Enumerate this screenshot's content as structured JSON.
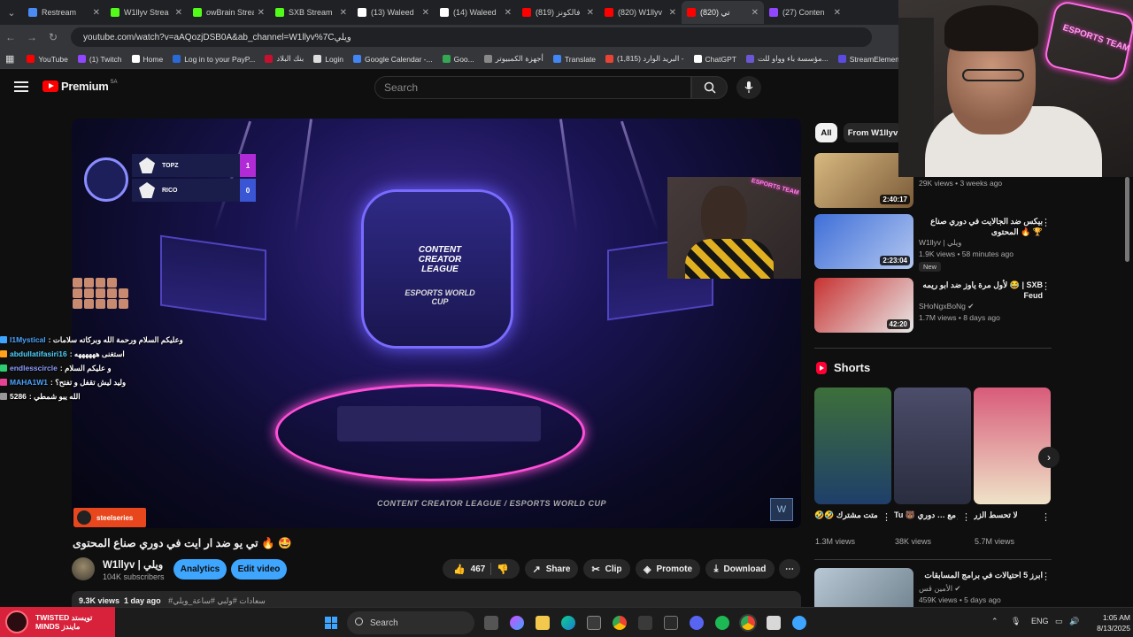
{
  "browser": {
    "tabs": [
      {
        "label": "Restream",
        "color": "#4a8bf5",
        "active": false
      },
      {
        "label": "W1llyv Strea",
        "color": "#53fc18",
        "active": false
      },
      {
        "label": "owBrain Strea",
        "color": "#53fc18",
        "active": false
      },
      {
        "label": "SXB Stream",
        "color": "#53fc18",
        "active": false
      },
      {
        "label": "(13) Waleed",
        "color": "#ffffff",
        "active": false
      },
      {
        "label": "(14) Waleed",
        "color": "#ffffff",
        "active": false
      },
      {
        "label": "(819) فالكونز",
        "color": "#ff0000",
        "active": false
      },
      {
        "label": "(820) W1llyv",
        "color": "#ff0000",
        "active": false
      },
      {
        "label": "(820) تي",
        "color": "#ff0000",
        "active": true
      },
      {
        "label": "(27) Conten",
        "color": "#9146ff",
        "active": false
      }
    ],
    "url": "youtube.com/watch?v=aAQozjDSB0A&ab_channel=W1llyv%7Cويلي",
    "bookmarks": [
      {
        "label": "YouTube",
        "color": "#ff0000"
      },
      {
        "label": "(1) Twitch",
        "color": "#9146ff"
      },
      {
        "label": "Home",
        "color": "#ffffff"
      },
      {
        "label": "Log in to your PayP...",
        "color": "#2a6ad8"
      },
      {
        "label": "بنك البلاد",
        "color": "#c8102e"
      },
      {
        "label": "Login",
        "color": "#dddddd"
      },
      {
        "label": "Google Calendar -...",
        "color": "#4285f4"
      },
      {
        "label": "Goo...",
        "color": "#34a853"
      },
      {
        "label": "أجهزة الكمبيوتر",
        "color": "#888888"
      },
      {
        "label": "Translate",
        "color": "#4285f4"
      },
      {
        "label": "(1,815) البريد الوارد -",
        "color": "#ea4335"
      },
      {
        "label": "ChatGPT",
        "color": "#ffffff"
      },
      {
        "label": "مؤسسة باء وواو للت...",
        "color": "#6b57d6"
      },
      {
        "label": "StreamElements - M",
        "color": "#5b4be3"
      }
    ]
  },
  "youtube": {
    "brand": "Premium",
    "country": "SA",
    "search_placeholder": "Search"
  },
  "video": {
    "scoreboard": [
      {
        "team": "TOPZ",
        "score": "1",
        "score_color": "#b02bd6"
      },
      {
        "team": "RICO",
        "score": "0",
        "score_color": "#3a56d4"
      }
    ],
    "stage_logo_top": "CONTENT CREATOR LEAGUE",
    "stage_logo_bottom": "ESPORTS WORLD CUP",
    "facecam_sign": "ESPORTS TEAM",
    "sponsor": "steelseries",
    "lower_banner": "CONTENT CREATOR LEAGUE / ESPORTS WORLD CUP",
    "corner_logo": "W"
  },
  "chat": [
    {
      "user": "I1Mystical",
      "user_color": "#4aa3ff",
      "msg": ": وعليكم السلام ورحمة الله وبركاته سلامات"
    },
    {
      "user": "abdullatifasiri16",
      "user_color": "#4fd1ff",
      "msg": ": استغنى ههههههه"
    },
    {
      "user": "endlesscircle",
      "user_color": "#8b9bff",
      "msg": ": و عليكم السلام"
    },
    {
      "user": "MAHA1W1",
      "user_color": "#4aa3ff",
      "msg": ": وليد ليش تقفل و تفتح؟"
    },
    {
      "user": "5286",
      "user_color": "#ffffff",
      "msg": ": الله يبو شمطي"
    }
  ],
  "meta": {
    "title": "تي يو ضد ار ايت في دوري صناع المحتوى 🔥 🤩",
    "channel_name": "W1llyv | ويلي",
    "subscribers": "104K subscribers",
    "analytics": "Analytics",
    "edit_video": "Edit video",
    "likes": "467",
    "share": "Share",
    "clip": "Clip",
    "promote": "Promote",
    "download": "Download",
    "more": "⋯",
    "views": "9.3K views",
    "age": "1 day ago",
    "tags": "#سعادات #ولبي #ساعة_ويلي"
  },
  "sidebar": {
    "chips": [
      "All",
      "From W1llyv"
    ],
    "recs": [
      {
        "title": "",
        "channel": "",
        "meta": "29K views • 3 weeks ago",
        "duration": "2:40:17",
        "new": false
      },
      {
        "title": "بيكس ضد الجالايت في دوري صناع المحتوى 🔥 🏆",
        "channel": "W1llyv | ويلي",
        "meta": "1.9K views • 58 minutes ago",
        "duration": "2:23:04",
        "new": true,
        "new_label": "New"
      },
      {
        "title": "لأول مرة ياوز ضد ابو ريمه 😂 | SXB Feud",
        "channel": "SHoNgxBoNg ✔",
        "meta": "1.7M views • 8 days ago",
        "duration": "42:20",
        "new": false
      }
    ],
    "shorts_label": "Shorts",
    "shorts": [
      {
        "title": "🤣🤣 وانا ... متت مشترك",
        "views": "1.3M views"
      },
      {
        "title": "Tu 🐻 ياسر مع … دوري R8 ضد",
        "views": "38K views"
      },
      {
        "title": "لا تحسط الزر",
        "views": "5.7M views"
      }
    ],
    "next_rec": {
      "title": "ابرز 5 احتيالات في برامج المسابقات",
      "channel": "الأمين قس ✔",
      "meta": "459K views • 5 days ago"
    }
  },
  "overlay": {
    "twisted_line1": "TWISTED تويستد",
    "twisted_line2": "MINDS مايندز",
    "webcam_sign": "ESPORTS TEAM"
  },
  "taskbar": {
    "search": "Search",
    "lang": "ENG",
    "time": "1:05 AM",
    "date": "8/13/2025"
  }
}
